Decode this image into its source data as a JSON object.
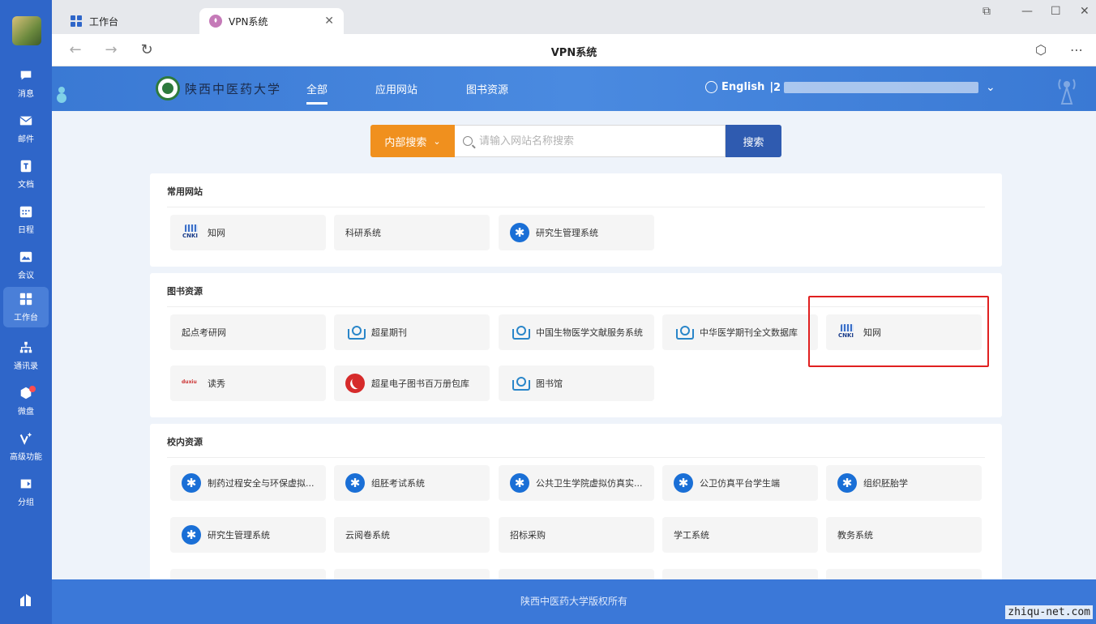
{
  "app_sidebar": {
    "items": [
      {
        "label": "消息",
        "icon": "chat-icon"
      },
      {
        "label": "邮件",
        "icon": "mail-icon"
      },
      {
        "label": "文档",
        "icon": "document-icon"
      },
      {
        "label": "日程",
        "icon": "calendar-icon"
      },
      {
        "label": "会议",
        "icon": "meeting-icon"
      },
      {
        "label": "工作台",
        "icon": "workbench-icon",
        "active": true
      },
      {
        "label": "通讯录",
        "icon": "contacts-icon"
      },
      {
        "label": "微盘",
        "icon": "drive-icon"
      },
      {
        "label": "高级功能",
        "icon": "advanced-icon"
      },
      {
        "label": "分组",
        "icon": "group-icon"
      }
    ]
  },
  "browser": {
    "tabs": [
      {
        "label": "工作台"
      },
      {
        "label": "VPN系统"
      }
    ],
    "page_title": "VPN系统"
  },
  "site": {
    "logo_text": "陕西中医药大学",
    "nav": [
      "全部",
      "应用网站",
      "图书资源"
    ],
    "language": "English",
    "separator": "|",
    "user_prefix": "2"
  },
  "search": {
    "type_label": "内部搜索",
    "placeholder": "请输入网站名称搜索",
    "button_label": "搜索"
  },
  "sections": [
    {
      "title": "常用网站",
      "items": [
        {
          "label": "知网",
          "icon": "cnki-icon"
        },
        {
          "label": "科研系统",
          "icon": ""
        },
        {
          "label": "研究生管理系统",
          "icon": "gear-icon"
        }
      ]
    },
    {
      "title": "图书资源",
      "items": [
        {
          "label": "起点考研网",
          "icon": ""
        },
        {
          "label": "超星期刊",
          "icon": "book-icon"
        },
        {
          "label": "中国生物医学文献服务系统",
          "icon": "book-icon"
        },
        {
          "label": "中华医学期刊全文数据库",
          "icon": "book-icon"
        },
        {
          "label": "知网",
          "icon": "cnki-icon"
        },
        {
          "label": "读秀",
          "icon": "duxiu-icon"
        },
        {
          "label": "超星电子图书百万册包库",
          "icon": "chaoxing-icon"
        },
        {
          "label": "图书馆",
          "icon": "book-icon"
        }
      ]
    },
    {
      "title": "校内资源",
      "items": [
        {
          "label": "制药过程安全与环保虚拟...",
          "icon": "gear-icon"
        },
        {
          "label": "组胚考试系统",
          "icon": "gear-icon"
        },
        {
          "label": "公共卫生学院虚拟仿真实...",
          "icon": "gear-icon"
        },
        {
          "label": "公卫仿真平台学生端",
          "icon": "gear-icon"
        },
        {
          "label": "组织胚胎学",
          "icon": "gear-icon"
        },
        {
          "label": "研究生管理系统",
          "icon": "gear-icon"
        },
        {
          "label": "云阅卷系统",
          "icon": ""
        },
        {
          "label": "招标采购",
          "icon": ""
        },
        {
          "label": "学工系统",
          "icon": ""
        },
        {
          "label": "教务系统",
          "icon": ""
        }
      ]
    }
  ],
  "footer": {
    "text": "陕西中医药大学版权所有"
  },
  "watermark": "zhiqu-net.com",
  "colors": {
    "sidebar": "#2f66c9",
    "accent_orange": "#f0901e",
    "search_button": "#2f5bb0",
    "highlight": "#e02020"
  }
}
